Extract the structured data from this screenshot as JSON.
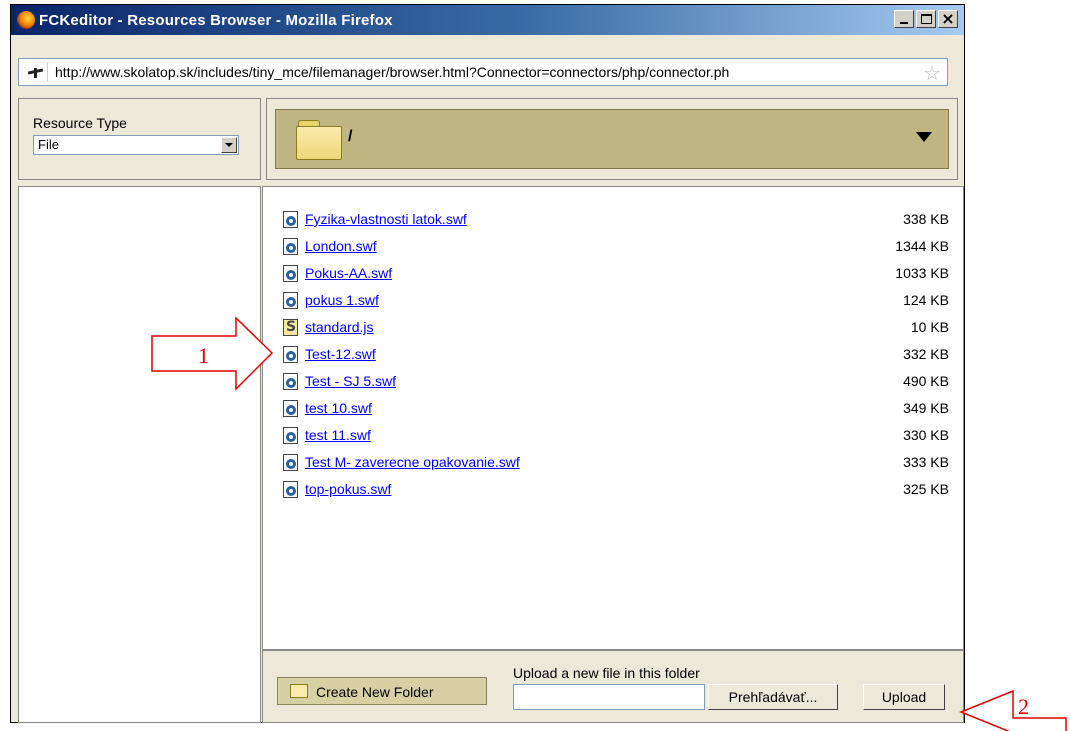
{
  "window": {
    "title": "FCKeditor - Resources Browser - Mozilla Firefox"
  },
  "address_bar": {
    "url": "http://www.skolatop.sk/includes/tiny_mce/filemanager/browser.html?Connector=connectors/php/connector.ph"
  },
  "resource_type": {
    "label": "Resource Type",
    "selected": "File"
  },
  "folder": {
    "current_path": "/"
  },
  "files": [
    {
      "name": "Fyzika-vlastnosti latok.swf",
      "size": "338 KB",
      "type": "swf"
    },
    {
      "name": "London.swf",
      "size": "1344 KB",
      "type": "swf"
    },
    {
      "name": "Pokus-AA.swf",
      "size": "1033 KB",
      "type": "swf"
    },
    {
      "name": "pokus 1.swf",
      "size": "124 KB",
      "type": "swf"
    },
    {
      "name": "standard.js",
      "size": "10 KB",
      "type": "js"
    },
    {
      "name": "Test-12.swf",
      "size": "332 KB",
      "type": "swf"
    },
    {
      "name": "Test - SJ 5.swf",
      "size": "490 KB",
      "type": "swf"
    },
    {
      "name": "test 10.swf",
      "size": "349 KB",
      "type": "swf"
    },
    {
      "name": "test 11.swf",
      "size": "330 KB",
      "type": "swf"
    },
    {
      "name": "Test M- zaverecne opakovanie.swf",
      "size": "333 KB",
      "type": "swf"
    },
    {
      "name": "top-pokus.swf",
      "size": "325 KB",
      "type": "swf"
    }
  ],
  "upload": {
    "create_folder_label": "Create New Folder",
    "upload_label": "Upload a new file in this folder",
    "browse_label": "Prehľadávať...",
    "upload_button_label": "Upload"
  },
  "annotations": {
    "arrow_1_label": "1",
    "arrow_2_label": "2",
    "color": "#e00000"
  }
}
